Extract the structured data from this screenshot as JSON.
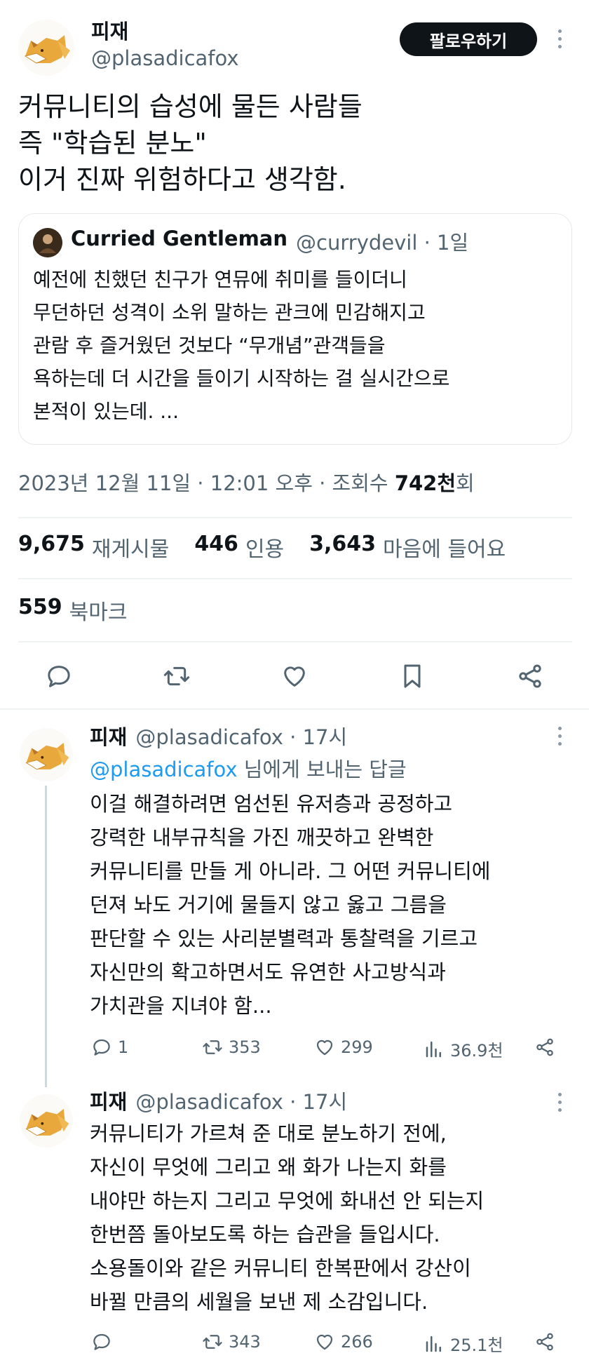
{
  "main_tweet": {
    "author_name": "피재",
    "author_handle": "@plasadicafox",
    "follow_label": "팔로우하기",
    "text": "커뮤니티의 습성에 물든 사람들\n즉 \"학습된 분노\"\n이거 진짜 위험하다고 생각함.",
    "quote": {
      "author_name": "Curried Gentleman",
      "meta": "@currydevil · 1일",
      "text": "예전에 친했던 친구가 연뮤에 취미를 들이더니\n무던하던 성격이 소위 말하는 관크에 민감해지고\n관람 후 즐거웠던 것보다 “무개념”관객들을\n욕하는데 더 시간을 들이기 시작하는 걸 실시간으로\n본적이 있는데. ..."
    },
    "timestamp": "2023년 12월 11일 · 12:01 오후 · 조회수 ",
    "views_num": "742천",
    "views_suffix": "회",
    "stats": {
      "retweets_num": "9,675",
      "retweets_label": "재게시물",
      "quotes_num": "446",
      "quotes_label": "인용",
      "likes_num": "3,643",
      "likes_label": "마음에 들어요",
      "bookmarks_num": "559",
      "bookmarks_label": "북마크"
    },
    "actions": [
      "reply-icon",
      "retweet-icon",
      "heart-icon",
      "bookmark-icon",
      "share-icon"
    ]
  },
  "replies": [
    {
      "author_name": "피재",
      "author_meta": "@plasadicafox · 17시",
      "reply_to_mention": "@plasadicafox",
      "reply_to_suffix": " 님에게 보내는 답글",
      "text": "이걸 해결하려면 엄선된 유저층과 공정하고\n강력한 내부규칙을 가진 깨끗하고 완벽한\n커뮤니티를 만들 게 아니라. 그 어떤 커뮤니티에\n던져 놔도 거기에 물들지 않고 옳고 그름을\n판단할 수 있는 사리분별력과 통찰력을 기르고\n자신만의 확고하면서도 유연한 사고방식과\n가치관을 지녀야 함...",
      "replies": "1",
      "retweets": "353",
      "likes": "299",
      "views": "36.9천"
    },
    {
      "author_name": "피재",
      "author_meta": "@plasadicafox · 17시",
      "text": "커뮤니티가 가르쳐 준 대로 분노하기 전에,\n자신이 무엇에 그리고 왜 화가 나는지 화를\n내야만 하는지 그리고 무엇에 화내선 안 되는지\n한번쯤 돌아보도록 하는 습관을 들입시다.\n소용돌이와 같은 커뮤니티 한복판에서 강산이\n바뀔 만큼의 세월을 보낸 제 소감입니다.",
      "replies": "",
      "retweets": "343",
      "likes": "266",
      "views": "25.1천"
    }
  ],
  "colors": {
    "text": "#0f1419",
    "secondary": "#536471",
    "link": "#1d9bf0",
    "divider": "#eff3f4"
  }
}
